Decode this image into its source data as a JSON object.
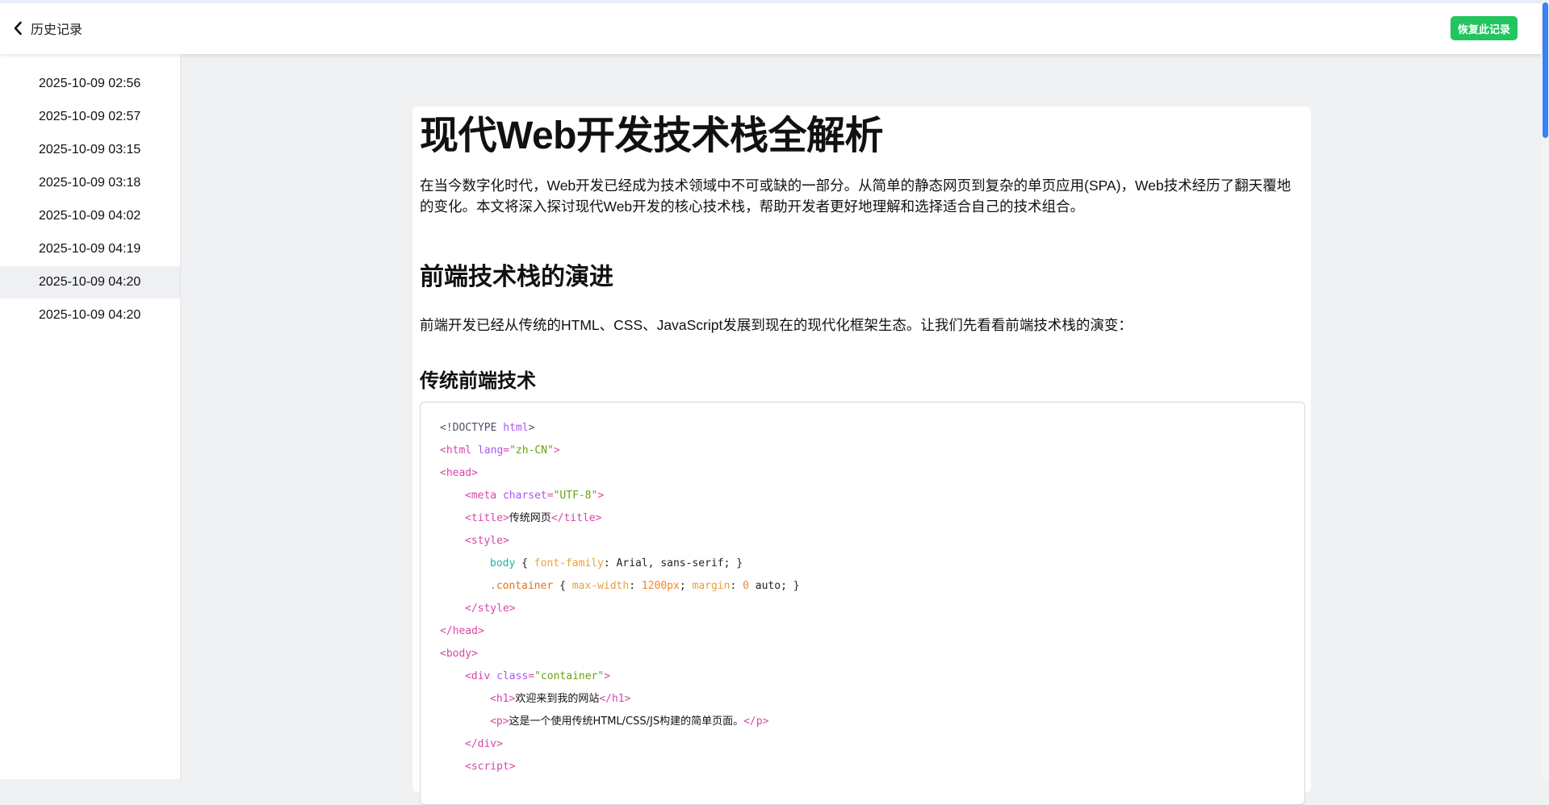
{
  "header": {
    "back_label": "历史记录",
    "restore_label": "恢复此记录"
  },
  "sidebar": {
    "items": [
      {
        "label": "2025-10-09 02:56",
        "active": false
      },
      {
        "label": "2025-10-09 02:57",
        "active": false
      },
      {
        "label": "2025-10-09 03:15",
        "active": false
      },
      {
        "label": "2025-10-09 03:18",
        "active": false
      },
      {
        "label": "2025-10-09 04:02",
        "active": false
      },
      {
        "label": "2025-10-09 04:19",
        "active": false
      },
      {
        "label": "2025-10-09 04:20",
        "active": true
      },
      {
        "label": "2025-10-09 04:20",
        "active": false
      }
    ]
  },
  "document": {
    "title": "现代Web开发技术栈全解析",
    "intro": "在当今数字化时代，Web开发已经成为技术领域中不可或缺的一部分。从简单的静态网页到复杂的单页应用(SPA)，Web技术经历了翻天覆地的变化。本文将深入探讨现代Web开发的核心技术栈，帮助开发者更好地理解和选择适合自己的技术组合。",
    "section_heading": "前端技术栈的演进",
    "section_paragraph": "前端开发已经从传统的HTML、CSS、JavaScript发展到现在的现代化框架生态。让我们先看看前端技术栈的演变：",
    "subsection_heading": "传统前端技术",
    "code_lines": [
      {
        "indent": 0,
        "tokens": [
          {
            "t": "<!DOCTYPE ",
            "c": "doctype"
          },
          {
            "t": "html",
            "c": "attr"
          },
          {
            "t": ">",
            "c": "doctype"
          }
        ]
      },
      {
        "indent": 0,
        "tokens": [
          {
            "t": "<html ",
            "c": "tag"
          },
          {
            "t": "lang",
            "c": "attr"
          },
          {
            "t": "=",
            "c": "tag"
          },
          {
            "t": "\"zh-CN\"",
            "c": "str"
          },
          {
            "t": ">",
            "c": "tag"
          }
        ]
      },
      {
        "indent": 0,
        "tokens": [
          {
            "t": "<head>",
            "c": "tag"
          }
        ]
      },
      {
        "indent": 1,
        "tokens": [
          {
            "t": "<meta ",
            "c": "tag"
          },
          {
            "t": "charset",
            "c": "attr"
          },
          {
            "t": "=",
            "c": "tag"
          },
          {
            "t": "\"UTF-8\"",
            "c": "str"
          },
          {
            "t": ">",
            "c": "tag"
          }
        ]
      },
      {
        "indent": 1,
        "tokens": [
          {
            "t": "<title>",
            "c": "tag"
          },
          {
            "t": "传统网页",
            "c": "text"
          },
          {
            "t": "</title>",
            "c": "tag"
          }
        ]
      },
      {
        "indent": 1,
        "tokens": [
          {
            "t": "<style>",
            "c": "tag"
          }
        ]
      },
      {
        "indent": 2,
        "tokens": [
          {
            "t": "body",
            "c": "sel"
          },
          {
            "t": " { ",
            "c": "plain"
          },
          {
            "t": "font-family",
            "c": "prop"
          },
          {
            "t": ": Arial, sans-serif; }",
            "c": "plain"
          }
        ]
      },
      {
        "indent": 2,
        "tokens": [
          {
            "t": ".container",
            "c": "cls"
          },
          {
            "t": " { ",
            "c": "plain"
          },
          {
            "t": "max-width",
            "c": "prop"
          },
          {
            "t": ": ",
            "c": "plain"
          },
          {
            "t": "1200px",
            "c": "num"
          },
          {
            "t": "; ",
            "c": "plain"
          },
          {
            "t": "margin",
            "c": "prop"
          },
          {
            "t": ": ",
            "c": "plain"
          },
          {
            "t": "0",
            "c": "num"
          },
          {
            "t": " auto; }",
            "c": "plain"
          }
        ]
      },
      {
        "indent": 1,
        "tokens": [
          {
            "t": "</style>",
            "c": "tag"
          }
        ]
      },
      {
        "indent": 0,
        "tokens": [
          {
            "t": "</head>",
            "c": "tag"
          }
        ]
      },
      {
        "indent": 0,
        "tokens": [
          {
            "t": "<body>",
            "c": "tag"
          }
        ]
      },
      {
        "indent": 1,
        "tokens": [
          {
            "t": "<div ",
            "c": "tag"
          },
          {
            "t": "class",
            "c": "attr"
          },
          {
            "t": "=",
            "c": "tag"
          },
          {
            "t": "\"container\"",
            "c": "str"
          },
          {
            "t": ">",
            "c": "tag"
          }
        ]
      },
      {
        "indent": 2,
        "tokens": [
          {
            "t": "<h1>",
            "c": "tag"
          },
          {
            "t": "欢迎来到我的网站",
            "c": "text"
          },
          {
            "t": "</h1>",
            "c": "tag"
          }
        ]
      },
      {
        "indent": 2,
        "tokens": [
          {
            "t": "<p>",
            "c": "tag"
          },
          {
            "t": "这是一个使用传统HTML/CSS/JS构建的简单页面。",
            "c": "text"
          },
          {
            "t": "</p>",
            "c": "tag"
          }
        ]
      },
      {
        "indent": 1,
        "tokens": [
          {
            "t": "</div>",
            "c": "tag"
          }
        ]
      },
      {
        "indent": 1,
        "tokens": [
          {
            "t": "<script>",
            "c": "tag"
          }
        ]
      }
    ]
  }
}
